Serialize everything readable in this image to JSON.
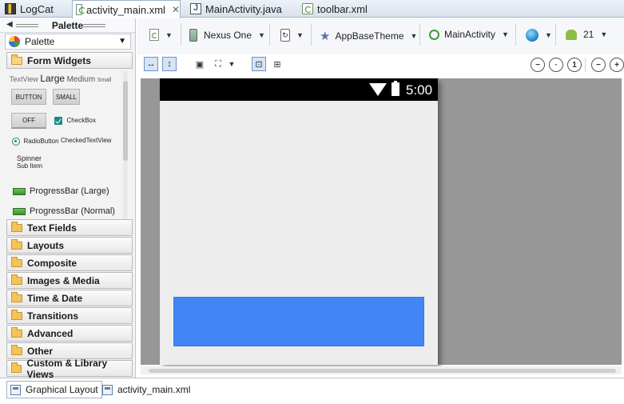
{
  "editor_tabs": [
    {
      "label": "LogCat",
      "icon": "logcat-icon",
      "active": false
    },
    {
      "label": "activity_main.xml",
      "icon": "xml-file-icon",
      "active": true,
      "closable": true
    },
    {
      "label": "MainActivity.java",
      "icon": "java-file-icon",
      "active": false
    },
    {
      "label": "toolbar.xml",
      "icon": "xml-file-icon",
      "active": false
    }
  ],
  "palette": {
    "title": "Palette",
    "selector_value": "Palette",
    "open_section": "Form Widgets",
    "widgets": {
      "textview": "TextView",
      "large": "Large",
      "medium": "Medium",
      "small_text": "Small",
      "button": "BUTTON",
      "small_button": "SMALL",
      "toggle": "OFF",
      "checkbox": "CheckBox",
      "radio": "RadioButton",
      "checked_textview": "CheckedTextView",
      "spinner": "Spinner",
      "spinner_sub": "Sub Item",
      "progress_large": "ProgressBar (Large)",
      "progress_normal": "ProgressBar (Normal)"
    },
    "sections": [
      "Text Fields",
      "Layouts",
      "Composite",
      "Images & Media",
      "Time & Date",
      "Transitions",
      "Advanced",
      "Other",
      "Custom & Library Views"
    ]
  },
  "toolbar": {
    "device": "Nexus One",
    "theme": "AppBaseTheme",
    "activity": "MainActivity",
    "api_level": "21"
  },
  "device_preview": {
    "time": "5:00",
    "view_color": "#4285f4"
  },
  "bottom_tabs": [
    {
      "label": "Graphical Layout",
      "active": true
    },
    {
      "label": "activity_main.xml",
      "active": false
    }
  ]
}
